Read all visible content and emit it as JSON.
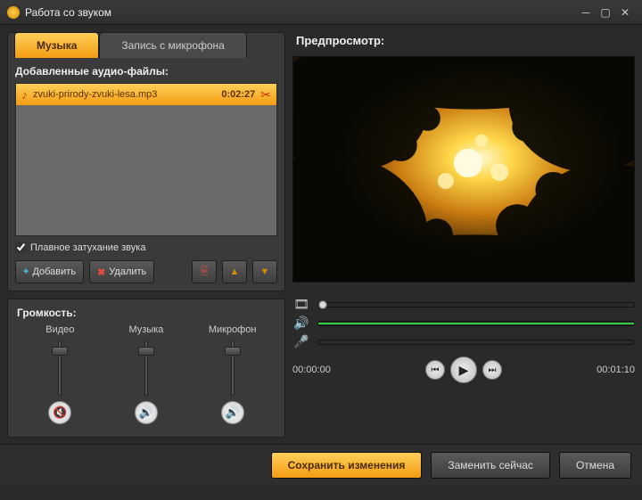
{
  "window": {
    "title": "Работа со звуком"
  },
  "tabs": {
    "music": "Музыка",
    "mic": "Запись с микрофона"
  },
  "files": {
    "header": "Добавленные аудио-файлы:",
    "item": {
      "name": "zvuki-prirody-zvuki-lesa.mp3",
      "duration": "0:02:27"
    },
    "fade_label": "Плавное затухание звука"
  },
  "buttons": {
    "add": "Добавить",
    "delete": "Удалить"
  },
  "volume": {
    "header": "Громкость:",
    "video": "Видео",
    "music": "Музыка",
    "mic": "Микрофон"
  },
  "preview": {
    "title": "Предпросмотр:"
  },
  "playback": {
    "current": "00:00:00",
    "total": "00:01:10"
  },
  "footer": {
    "save": "Сохранить изменения",
    "replace": "Заменить сейчас",
    "cancel": "Отмена"
  }
}
